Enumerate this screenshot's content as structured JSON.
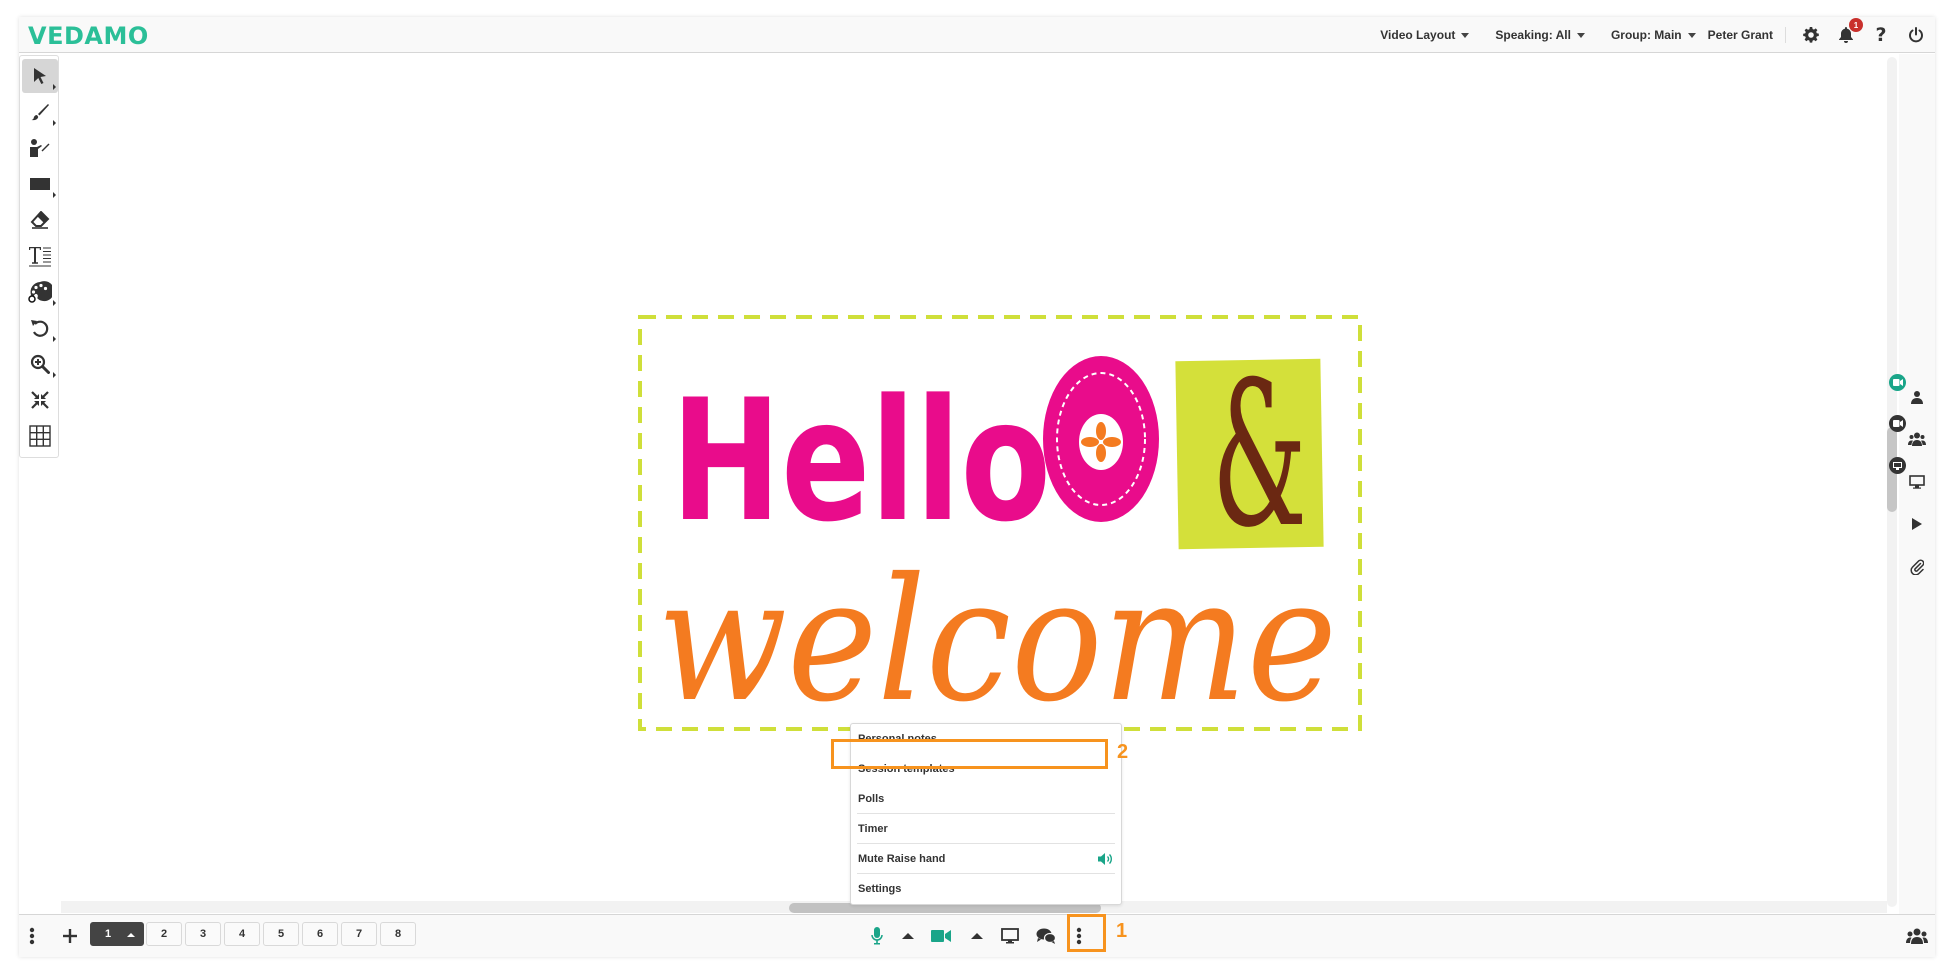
{
  "header": {
    "logo": "VEDAMO",
    "dropdowns": [
      {
        "label": "Video Layout"
      },
      {
        "label": "Speaking: All"
      },
      {
        "label": "Group: Main"
      }
    ],
    "user_name": "Peter Grant",
    "icons": [
      "gear-icon",
      "bell-icon",
      "help-icon",
      "power-icon"
    ],
    "notification_count": "1"
  },
  "toolbar": {
    "tools": [
      {
        "name": "select-tool",
        "icon": "cursor-arrow-icon",
        "has_submenu": true,
        "active": true
      },
      {
        "name": "brush-tool",
        "icon": "paintbrush-icon",
        "has_submenu": true
      },
      {
        "name": "presenter-tool",
        "icon": "presenter-icon",
        "has_submenu": false
      },
      {
        "name": "shape-tool",
        "icon": "rectangle-icon",
        "has_submenu": true
      },
      {
        "name": "eraser-tool",
        "icon": "eraser-icon",
        "has_submenu": false
      },
      {
        "name": "text-tool",
        "icon": "text-icon",
        "has_submenu": false
      },
      {
        "name": "color-tool",
        "icon": "palette-icon",
        "has_submenu": true
      },
      {
        "name": "undo-tool",
        "icon": "undo-icon",
        "has_submenu": true
      },
      {
        "name": "zoom-tool",
        "icon": "zoom-in-icon",
        "has_submenu": true
      },
      {
        "name": "fit-tool",
        "icon": "compress-icon",
        "has_submenu": false
      },
      {
        "name": "grid-tool",
        "icon": "grid-icon",
        "has_submenu": false
      }
    ]
  },
  "canvas": {
    "image_text_line1": "Hello",
    "image_text_ampersand": "&",
    "image_text_line2": "welcome",
    "colors": {
      "pink": "#e90c8b",
      "orange": "#f47b20",
      "lime": "#d4e03a",
      "brown": "#6b2812",
      "dash": "#cfdf3a"
    }
  },
  "right_rail": {
    "items": [
      "user-video-icon",
      "group-video-icon",
      "screen-share-icon",
      "play-icon",
      "attachment-icon"
    ]
  },
  "menu": {
    "items": [
      {
        "label": "Personal notes"
      },
      {
        "label": "Session templates"
      },
      {
        "label": "Polls"
      },
      {
        "label": "Timer"
      },
      {
        "label": "Mute Raise hand",
        "icon": "speaker-icon"
      },
      {
        "label": "Settings"
      }
    ]
  },
  "bottombar": {
    "pages": [
      "1",
      "2",
      "3",
      "4",
      "5",
      "6",
      "7",
      "8"
    ],
    "active_page": "1"
  },
  "annotations": {
    "step1": "1",
    "step2": "2",
    "color": "#f7931e"
  },
  "colors": {
    "brand": "#2bbf98",
    "accent_teal": "#1aa589",
    "badge_red": "#c9302c"
  }
}
